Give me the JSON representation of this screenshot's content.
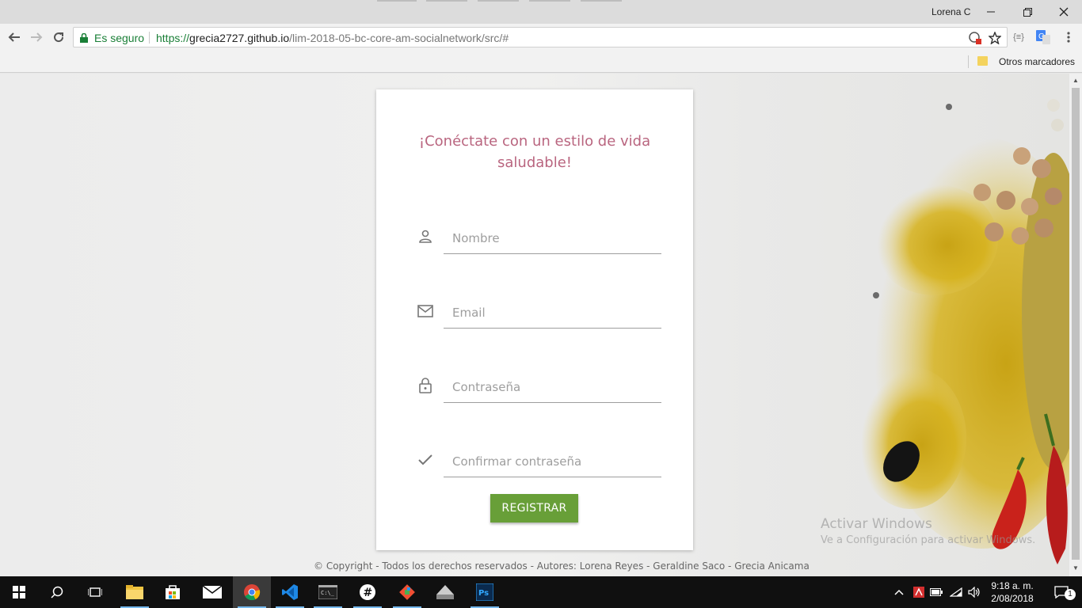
{
  "browser": {
    "profile_name": "Lorena C",
    "secure_label": "Es seguro",
    "url_scheme": "https://",
    "url_host": "grecia2727.github.io",
    "url_path": "/lim-2018-05-bc-core-am-socialnetwork/src/#",
    "bookmarks_other_label": "Otros marcadores",
    "accent_secure": "#1a7f37"
  },
  "card": {
    "heading": "¡Conéctate con un estilo de vida saludable!",
    "fields": [
      {
        "placeholder": "Nombre",
        "icon": "person-icon"
      },
      {
        "placeholder": "Email",
        "icon": "mail-icon"
      },
      {
        "placeholder": "Contraseña",
        "icon": "lock-icon"
      },
      {
        "placeholder": "Confirmar contraseña",
        "icon": "check-icon"
      }
    ],
    "submit_label": "REGISTRAR",
    "heading_color": "#b9657f",
    "button_color": "#689f38"
  },
  "footer": {
    "copyright_symbol": "©",
    "text": "Copyright - Todos los derechos reservados - Autores: Lorena Reyes - Geraldine Saco - Grecia Anicama"
  },
  "watermark": {
    "line1": "Activar Windows",
    "line2": "Ve a Configuración para activar Windows."
  },
  "taskbar": {
    "time": "9:18 a. m.",
    "date": "2/08/2018",
    "notification_count": "1"
  }
}
